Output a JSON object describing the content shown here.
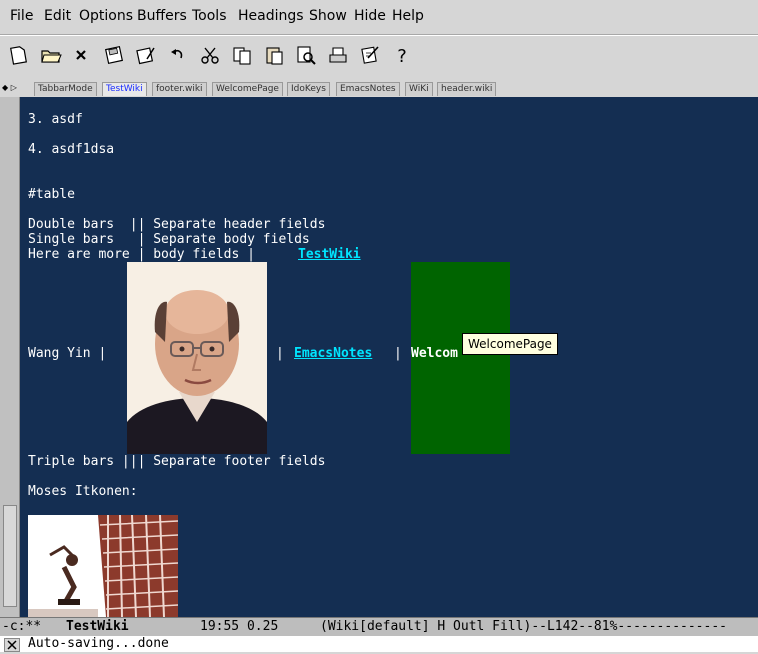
{
  "menu": {
    "items": [
      "File",
      "Edit",
      "Options",
      "Buffers",
      "Tools",
      "Headings",
      "Show",
      "Hide",
      "Help"
    ]
  },
  "toolbar": {
    "tools": [
      "new-file",
      "open-folder",
      "close",
      "save",
      "save-as",
      "undo",
      "cut",
      "copy",
      "paste",
      "search",
      "print",
      "preferences",
      "help"
    ],
    "help_glyph": "?"
  },
  "tabs": {
    "nav_glyph": "◆ ▷",
    "items": [
      {
        "label": "TabbarMode",
        "active": false
      },
      {
        "label": "TestWiki",
        "active": true
      },
      {
        "label": "footer.wiki",
        "active": false
      },
      {
        "label": "WelcomePage",
        "active": false
      },
      {
        "label": "IdoKeys",
        "active": false
      },
      {
        "label": "EmacsNotes",
        "active": false
      },
      {
        "label": "WiKi",
        "active": false
      },
      {
        "label": "header.wiki",
        "active": false
      }
    ]
  },
  "buffer": {
    "lines": {
      "item3": "3. asdf",
      "item4": "4. asdf1dsa",
      "table_marker": "#table",
      "double_bars": "Double bars  || Separate header fields",
      "single_bars": "Single bars   | Separate body fields",
      "here_more": "Here are more | body fields | ",
      "wang_yin": "Wang Yin |",
      "pipe1": "|",
      "pipe2": "|",
      "welcome_partial": "Welcom",
      "triple_bars": "Triple bars ||| Separate footer fields",
      "moses": "Moses Itkonen:"
    },
    "links": {
      "testwiki": "TestWiki",
      "emacsnotes": "EmacsNotes"
    },
    "tooltip": "WelcomePage",
    "colors": {
      "background": "#142e52",
      "text": "#ffffff",
      "link": "#00e5ff",
      "green_cell": "#006400"
    }
  },
  "modeline": {
    "status": "-c:**",
    "buffer_name": "TestWiki",
    "time_load": "19:55 0.25",
    "mode": "(Wiki[default] H Outl Fill)--L142--81%--------------"
  },
  "minibuffer": {
    "message": "Auto-saving...done"
  }
}
